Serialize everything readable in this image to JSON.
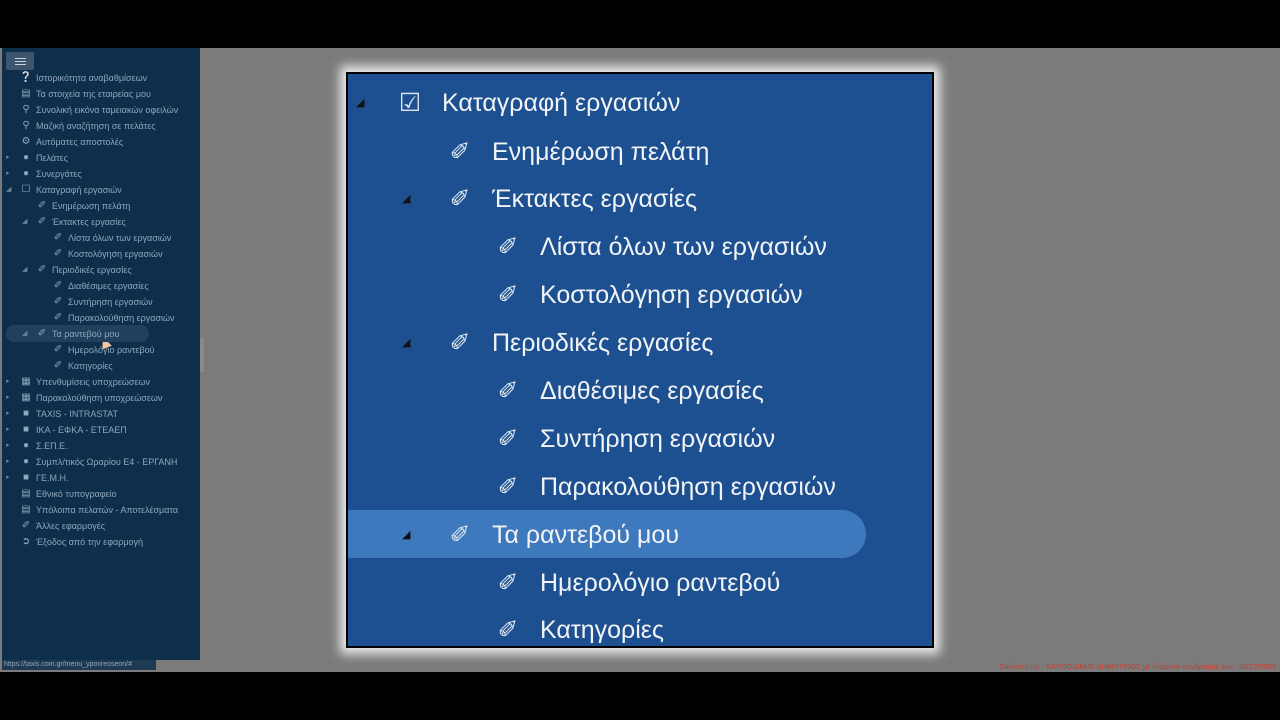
{
  "sidebar": {
    "items": [
      {
        "label": "Ιστορικότητα αναβαθμίσεων",
        "icon": "question-circle-icon"
      },
      {
        "label": "Τα στοιχεία της εταιρείας μου",
        "icon": "document-icon"
      },
      {
        "label": "Συνολική εικόνα ταμειακών οφειλών",
        "icon": "search-icon"
      },
      {
        "label": "Μαζική αναζήτηση σε πελάτες",
        "icon": "search-icon"
      },
      {
        "label": "Αυτόματες αποστολές",
        "icon": "gears-icon"
      },
      {
        "label": "Πελάτες",
        "icon": "user-icon"
      },
      {
        "label": "Συνεργάτες",
        "icon": "users-icon"
      },
      {
        "label": "Καταγραφή εργασιών",
        "icon": "clipboard-icon"
      },
      {
        "label": "Ενημέρωση πελάτη",
        "icon": "paperclip-icon"
      },
      {
        "label": "Έκτακτες εργασίες",
        "icon": "paperclip-icon"
      },
      {
        "label": "Λίστα όλων των εργασιών",
        "icon": "paperclip-icon"
      },
      {
        "label": "Κοστολόγηση εργασιών",
        "icon": "paperclip-icon"
      },
      {
        "label": "Περιοδικές εργασίες",
        "icon": "paperclip-icon"
      },
      {
        "label": "Διαθέσιμες εργασίες",
        "icon": "paperclip-icon"
      },
      {
        "label": "Συντήρηση εργασιών",
        "icon": "paperclip-icon"
      },
      {
        "label": "Παρακολούθηση εργασιών",
        "icon": "paperclip-icon"
      },
      {
        "label": "Τα ραντεβού μου",
        "icon": "paperclip-icon"
      },
      {
        "label": "Ημερολόγιο ραντεβού",
        "icon": "paperclip-icon"
      },
      {
        "label": "Κατηγορίες",
        "icon": "paperclip-icon"
      },
      {
        "label": "Υπενθυμίσεις υποχρεώσεων",
        "icon": "calendar-icon"
      },
      {
        "label": "Παρακολούθηση υποχρεώσεων",
        "icon": "calendar-icon"
      },
      {
        "label": "TAXIS - INTRASTAT",
        "icon": "book-icon"
      },
      {
        "label": "ΙΚΑ - ΕΦΚΑ - ΕΤΕΑΕΠ",
        "icon": "book-icon"
      },
      {
        "label": "Σ.ΕΠ.Ε.",
        "icon": "user-icon"
      },
      {
        "label": "Συμπλ/τικός Ωραρίου Ε4 - ΕΡΓΑΝΗ",
        "icon": "users-icon"
      },
      {
        "label": "ΓΕ.Μ.Η.",
        "icon": "book-icon"
      },
      {
        "label": "Εθνικό τυπογραφείο",
        "icon": "document-icon"
      },
      {
        "label": "Υπόλοιπα πελατών - Αποτελέσματα",
        "icon": "document-icon"
      },
      {
        "label": "Άλλες εφαρμογές",
        "icon": "paperclip-icon"
      },
      {
        "label": "Έξοδος από την εφαρμογή",
        "icon": "exit-icon"
      }
    ]
  },
  "zoom_panel": {
    "items": [
      {
        "label": "Καταγραφή εργασιών",
        "icon": "clipboard-icon"
      },
      {
        "label": "Ενημέρωση πελάτη",
        "icon": "paperclip-icon"
      },
      {
        "label": "Έκτακτες εργασίες",
        "icon": "paperclip-icon"
      },
      {
        "label": "Λίστα όλων των εργασιών",
        "icon": "paperclip-icon"
      },
      {
        "label": "Κοστολόγηση εργασιών",
        "icon": "paperclip-icon"
      },
      {
        "label": "Περιοδικές εργασίες",
        "icon": "paperclip-icon"
      },
      {
        "label": "Διαθέσιμες εργασίες",
        "icon": "paperclip-icon"
      },
      {
        "label": "Συντήρηση εργασιών",
        "icon": "paperclip-icon"
      },
      {
        "label": "Παρακολούθηση εργασιών",
        "icon": "paperclip-icon"
      },
      {
        "label": "Τα ραντεβού μου",
        "icon": "paperclip-icon"
      },
      {
        "label": "Ημερολόγιο ραντεβού",
        "icon": "paperclip-icon"
      },
      {
        "label": "Κατηγορίες",
        "icon": "paperclip-icon"
      }
    ]
  },
  "status": {
    "url": "https://taxis.com.gr/menu_ypoxreoseon/#",
    "login": "Σύνδεση ως : ΚΑΡΠΟΔΙΝΗΣ ΔΗΜΗΤΡΙΟΣ με διάρκεια συνδρομής έως :20/12/2023"
  },
  "colors": {
    "sidebar_bg": "#0d2f4b",
    "panel_bg": "#1d5090",
    "selected_bg": "#3f79bd",
    "login_text": "#d23a2a"
  }
}
